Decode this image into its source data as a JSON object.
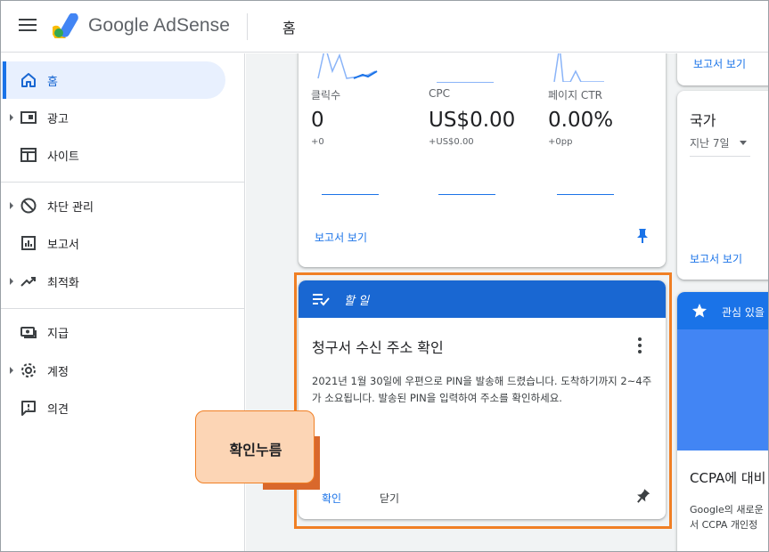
{
  "header": {
    "brand": "Google AdSense",
    "page_title": "홈"
  },
  "sidebar": {
    "items": [
      {
        "label": "홈",
        "icon": "home-icon",
        "active": true
      },
      {
        "label": "광고",
        "icon": "ads-icon"
      },
      {
        "label": "사이트",
        "icon": "sites-icon"
      },
      {
        "label": "차단 관리",
        "icon": "block-icon"
      },
      {
        "label": "보고서",
        "icon": "reports-icon"
      },
      {
        "label": "최적화",
        "icon": "trending-icon"
      },
      {
        "label": "지급",
        "icon": "payments-icon"
      },
      {
        "label": "계정",
        "icon": "gear-icon"
      },
      {
        "label": "의견",
        "icon": "feedback-icon"
      }
    ]
  },
  "stats": {
    "metrics": [
      {
        "label": "클릭수",
        "value": "0",
        "delta": "+0"
      },
      {
        "label": "CPC",
        "value": "US$0.00",
        "delta": "+US$0.00"
      },
      {
        "label": "페이지 CTR",
        "value": "0.00%",
        "delta": "+0pp"
      }
    ],
    "report_link": "보고서 보기"
  },
  "right_top": {
    "report_link": "보고서 보기"
  },
  "country": {
    "title": "국가",
    "range": "지난 7일",
    "report_link": "보고서 보기"
  },
  "interest": {
    "label": "관심 있을",
    "ccpa_title": "CCPA에 대비",
    "ccpa_line1": "Google의 새로운",
    "ccpa_line2": "서 CCPA 개인정"
  },
  "todo": {
    "header": "할 일",
    "title": "청구서 수신 주소 확인",
    "body": "2021년 1월 30일에 우편으로 PIN을 발송해 드렸습니다. 도착하기까지 2~4주가 소요됩니다. 발송된 PIN을 입력하여 주소를 확인하세요.",
    "confirm": "확인",
    "close": "닫기"
  },
  "annotation": {
    "callout": "확인누름"
  },
  "colors": {
    "primary": "#1a73e8",
    "header_blue": "#1967d2",
    "annotation_orange": "#f07f24",
    "callout_fill": "#fcd5b5"
  }
}
